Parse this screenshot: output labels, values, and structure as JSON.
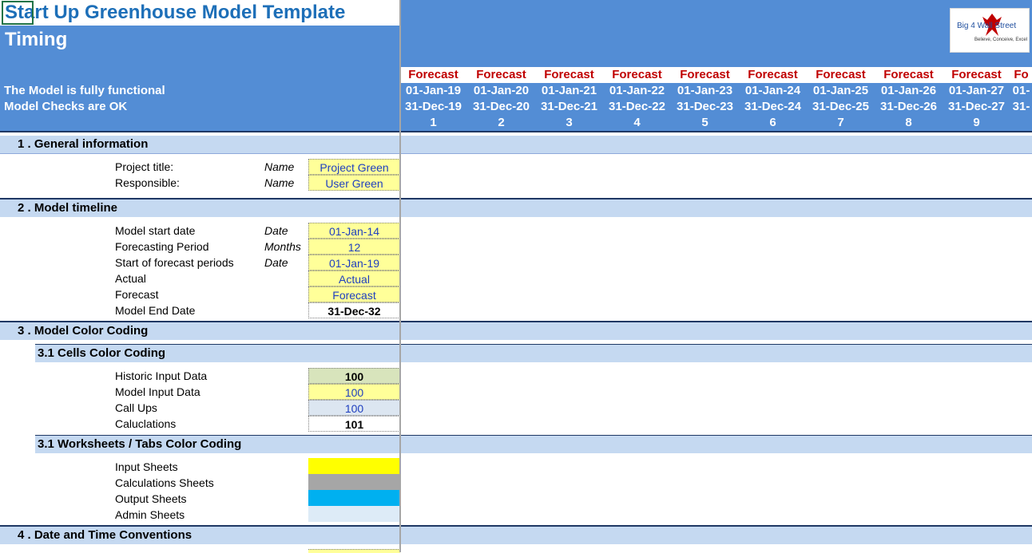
{
  "header": {
    "title": "Start Up Greenhouse Model Template",
    "subtitle": "Timing",
    "status_functional": "The Model is fully functional",
    "status_checks": "Model Checks are OK",
    "logo": {
      "text": "Big 4 Wall Street",
      "tagline": "Believe, Conceive, Excel"
    }
  },
  "timeline_columns": [
    {
      "label": "Forecast",
      "start": "01-Jan-19",
      "end": "31-Dec-19",
      "num": "1"
    },
    {
      "label": "Forecast",
      "start": "01-Jan-20",
      "end": "31-Dec-20",
      "num": "2"
    },
    {
      "label": "Forecast",
      "start": "01-Jan-21",
      "end": "31-Dec-21",
      "num": "3"
    },
    {
      "label": "Forecast",
      "start": "01-Jan-22",
      "end": "31-Dec-22",
      "num": "4"
    },
    {
      "label": "Forecast",
      "start": "01-Jan-23",
      "end": "31-Dec-23",
      "num": "5"
    },
    {
      "label": "Forecast",
      "start": "01-Jan-24",
      "end": "31-Dec-24",
      "num": "6"
    },
    {
      "label": "Forecast",
      "start": "01-Jan-25",
      "end": "31-Dec-25",
      "num": "7"
    },
    {
      "label": "Forecast",
      "start": "01-Jan-26",
      "end": "31-Dec-26",
      "num": "8"
    },
    {
      "label": "Forecast",
      "start": "01-Jan-27",
      "end": "31-Dec-27",
      "num": "9"
    },
    {
      "label": "Fo",
      "start": "01-",
      "end": "31-",
      "num": ""
    }
  ],
  "sections": {
    "s1": {
      "title": "1 . General information",
      "rows": [
        {
          "label": "Project title:",
          "unit": "Name",
          "value": "Project Green"
        },
        {
          "label": "Responsible:",
          "unit": "Name",
          "value": "User Green"
        }
      ]
    },
    "s2": {
      "title": "2 . Model timeline",
      "rows": [
        {
          "label": "Model start date",
          "unit": "Date",
          "value": "01-Jan-14"
        },
        {
          "label": "Forecasting Period",
          "unit": "Months",
          "value": "12"
        },
        {
          "label": "Start of forecast periods",
          "unit": "Date",
          "value": "01-Jan-19"
        },
        {
          "label": "Actual",
          "unit": "",
          "value": "Actual"
        },
        {
          "label": "Forecast",
          "unit": "",
          "value": "Forecast"
        },
        {
          "label": "Model End Date",
          "unit": "",
          "value": "31-Dec-32"
        }
      ]
    },
    "s3": {
      "title": "3 . Model Color Coding",
      "sub1": {
        "title": "3.1 Cells Color Coding",
        "rows": [
          {
            "label": "Historic Input Data",
            "value": "100"
          },
          {
            "label": "Model Input Data",
            "value": "100"
          },
          {
            "label": "Call Ups",
            "value": "100"
          },
          {
            "label": "Caluclations",
            "value": "101"
          }
        ]
      },
      "sub2": {
        "title": "3.1 Worksheets / Tabs Color Coding",
        "rows": [
          {
            "label": "Input Sheets",
            "color": "#FFFF00"
          },
          {
            "label": "Calculations Sheets",
            "color": "#A6A6A6"
          },
          {
            "label": "Output Sheets",
            "color": "#00B0F0"
          },
          {
            "label": "Admin Sheets",
            "color": "#DDEBF7"
          }
        ]
      }
    },
    "s4": {
      "title": "4 . Date and Time Conventions"
    }
  },
  "colors": {
    "header_blue": "#538DD5",
    "band_blue": "#C5D9F1",
    "forecast_red": "#C00000",
    "input_yellow": "#FFFF99"
  }
}
